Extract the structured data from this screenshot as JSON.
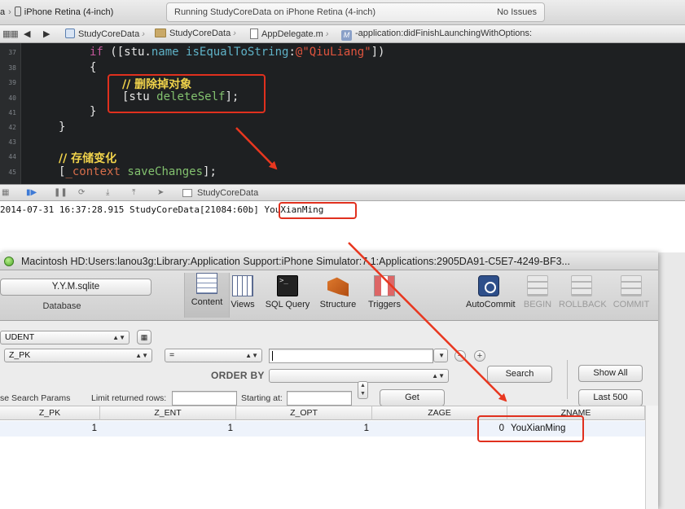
{
  "xcode": {
    "scheme_prefix": "a",
    "scheme_device": "iPhone Retina (4-inch)",
    "status_text": "Running StudyCoreData on iPhone Retina (4-inch)",
    "issues_text": "No Issues",
    "jump_bar": {
      "project": "StudyCoreData",
      "group": "StudyCoreData",
      "file": "AppDelegate.m",
      "method": "-application:didFinishLaunchingWithOptions:"
    }
  },
  "editor": {
    "line_numbers": [
      "37",
      "38",
      "39",
      "40",
      "41",
      "42",
      "43",
      "44",
      "45"
    ],
    "lines": {
      "l37_if": "if",
      "l37_a": " ([stu.",
      "l37_name": "name",
      "l37_b": " ",
      "l37_meth": "isEqualToString",
      "l37_c": ":",
      "l37_str": "@\"QiuLiang\"",
      "l37_d": "])",
      "l38": "{",
      "l39_comment": "// 删除掉对象",
      "l40_a": "[stu ",
      "l40_msg": "deleteSelf",
      "l40_b": "];",
      "l41": "}",
      "l42": "}",
      "l44_comment": "// 存储变化",
      "l45_a": "[",
      "l45_ivar": "_context",
      "l45_b": " ",
      "l45_msg": "saveChanges",
      "l45_c": "];"
    }
  },
  "debug_bar": {
    "target_label": "StudyCoreData"
  },
  "console": {
    "log_prefix": "2014-07-31 16:37:28.915 StudyCoreData[21084:60b]",
    "log_value": "YouXianMing"
  },
  "sqlite": {
    "window_title": "Macintosh HD:Users:lanou3g:Library:Application Support:iPhone Simulator:7.1:Applications:2905DA91-C5E7-4249-BF3...",
    "database_name": "Y.Y.M.sqlite",
    "database_label": "Database",
    "tools": {
      "content": "Content",
      "views": "Views",
      "sql_query": "SQL Query",
      "structure": "Structure",
      "triggers": "Triggers",
      "autocommit": "AutoCommit",
      "begin": "BEGIN",
      "rollback": "ROLLBACK",
      "commit": "COMMIT"
    },
    "filter": {
      "table_select": "UDENT",
      "column_select": "Z_PK",
      "operator_select": "=",
      "value_input": "",
      "order_by_label": "ORDER BY",
      "order_by_select": "",
      "search_button": "Search",
      "show_all_button": "Show All",
      "last500_button": "Last 500",
      "use_search_label": "se Search Params",
      "limit_label": "Limit returned rows:",
      "limit_value": "",
      "starting_label": "Starting at:",
      "starting_value": "",
      "get_button": "Get"
    },
    "columns": [
      "Z_PK",
      "Z_ENT",
      "Z_OPT",
      "ZAGE",
      "ZNAME"
    ],
    "rows": [
      {
        "z_pk": "1",
        "z_ent": "1",
        "z_opt": "1",
        "zage": "0",
        "zname": "YouXianMing"
      }
    ]
  },
  "colors": {
    "highlight_box": "#e0301e",
    "arrow": "#e8371f"
  }
}
